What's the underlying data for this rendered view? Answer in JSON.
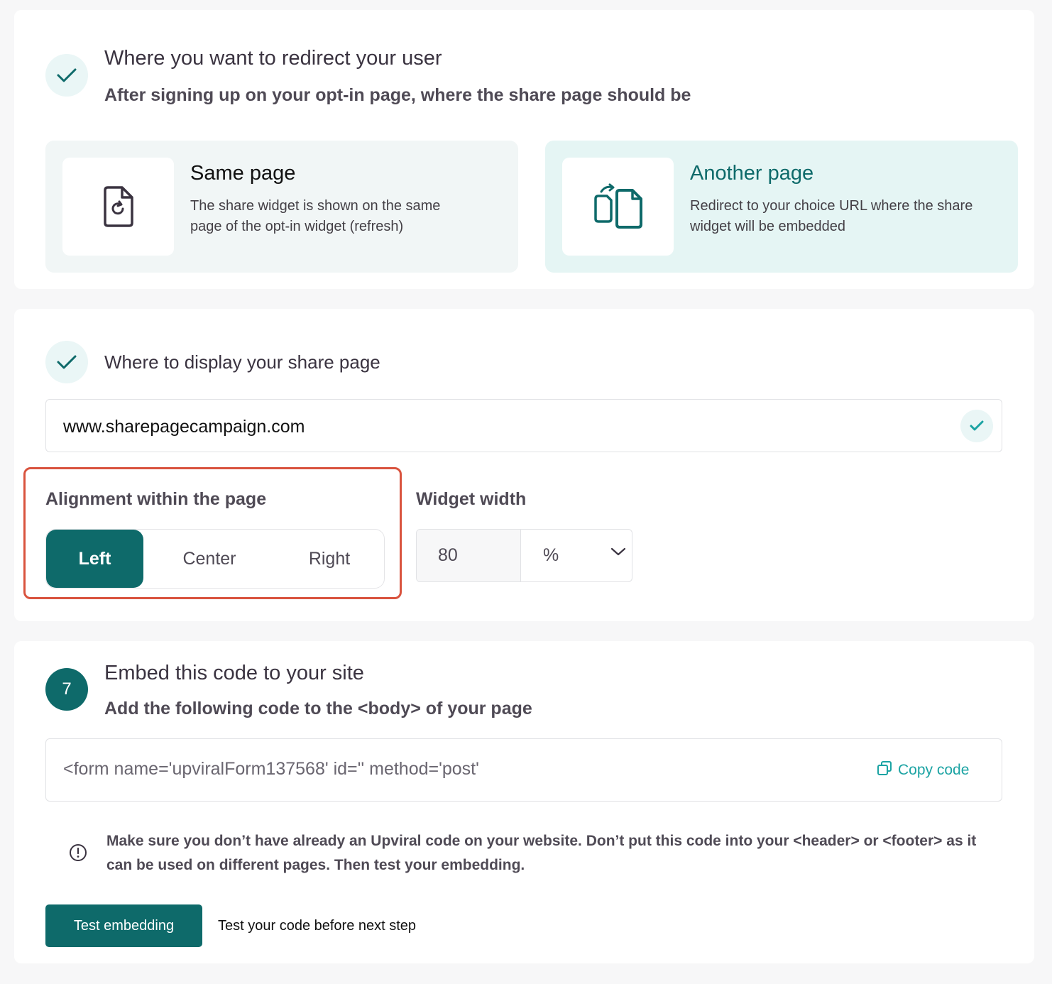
{
  "colors": {
    "accent": "#0e6a6a",
    "accent_light": "#eaf6f6",
    "link": "#1ba3a3",
    "highlight_border": "#d9533e",
    "page_bg": "#f7f7f8"
  },
  "redirect_section": {
    "title": "Where you want to redirect your user",
    "subtitle": "After signing up on your opt-in page, where the share page should be",
    "status_icon": "check-icon",
    "options": [
      {
        "title": "Same page",
        "description": "The share widget is shown on the same page of the opt-in widget (refresh)",
        "icon": "refresh-document-icon",
        "selected": false
      },
      {
        "title": "Another page",
        "description": "Redirect to your choice URL where the share widget will be embedded",
        "icon": "copy-pages-icon",
        "selected": true
      }
    ]
  },
  "display_section": {
    "title": "Where to display your share page",
    "status_icon": "check-icon",
    "url_value": "www.sharepagecampaign.com",
    "url_valid_icon": "check-icon",
    "alignment": {
      "label": "Alignment within the page",
      "options": [
        "Left",
        "Center",
        "Right"
      ],
      "selected": "Left"
    },
    "widget_width": {
      "label": "Widget width",
      "value": "80",
      "unit": "%"
    }
  },
  "embed_section": {
    "step_number": "7",
    "title": "Embed this code to your site",
    "subtitle": "Add the following code to the <body> of your page",
    "code_snippet": "<form name='upviralForm137568' id='' method='post'",
    "copy_label": "Copy code",
    "warning_icon": "info-icon",
    "warning": "Make sure you don’t have already an Upviral code on your website. Don’t put this code into your <header> or <footer> as it can be used on different pages. Then test your embedding.",
    "test_button": "Test embedding",
    "test_hint": "Test your code before next step"
  }
}
